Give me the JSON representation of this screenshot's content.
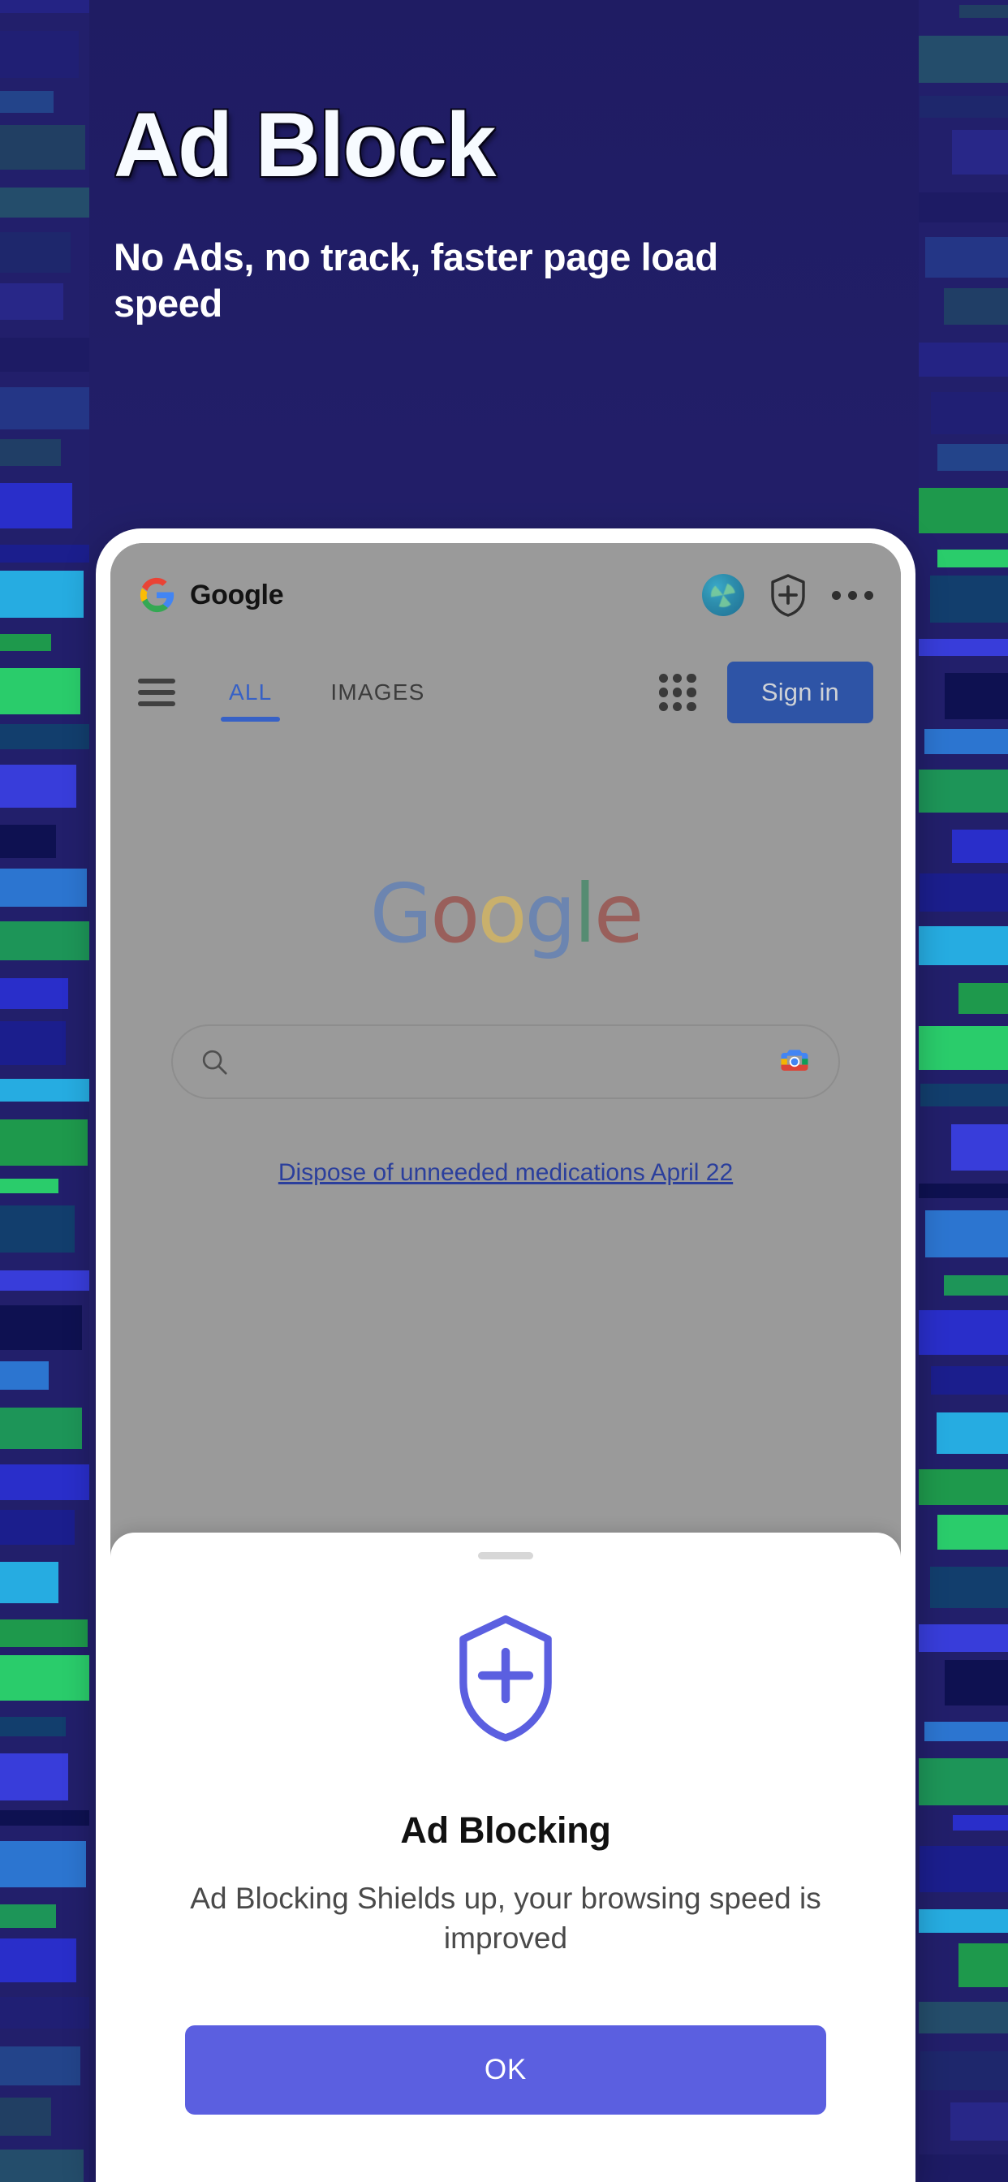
{
  "hero": {
    "title": "Ad Block",
    "subtitle": "No Ads, no track, faster page load speed"
  },
  "colors": {
    "background": "#221f6b",
    "accent": "#5b5fe0",
    "google_blue": "#3761c6",
    "signin_blue": "#2e54a6",
    "dim_overlay": "#9a9a9a"
  },
  "phone": {
    "browser": {
      "topbar": {
        "site_name": "Google",
        "icons": [
          "google-g-icon",
          "browser-refresh-icon",
          "shield-plus-icon",
          "overflow-menu-icon"
        ]
      },
      "tabs": [
        {
          "label": "ALL",
          "active": true
        },
        {
          "label": "IMAGES",
          "active": false
        }
      ],
      "apps_grid_label": "Google apps",
      "signin_label": "Sign in",
      "logo": {
        "letters": [
          "G",
          "o",
          "o",
          "g",
          "l",
          "e"
        ]
      },
      "search": {
        "value": "",
        "placeholder": ""
      },
      "promo_link": "Dispose of unneeded medications April 22"
    },
    "sheet": {
      "icon": "shield-plus-icon",
      "title": "Ad Blocking",
      "description": "Ad Blocking Shields up, your browsing speed is improved",
      "ok_label": "OK"
    }
  }
}
